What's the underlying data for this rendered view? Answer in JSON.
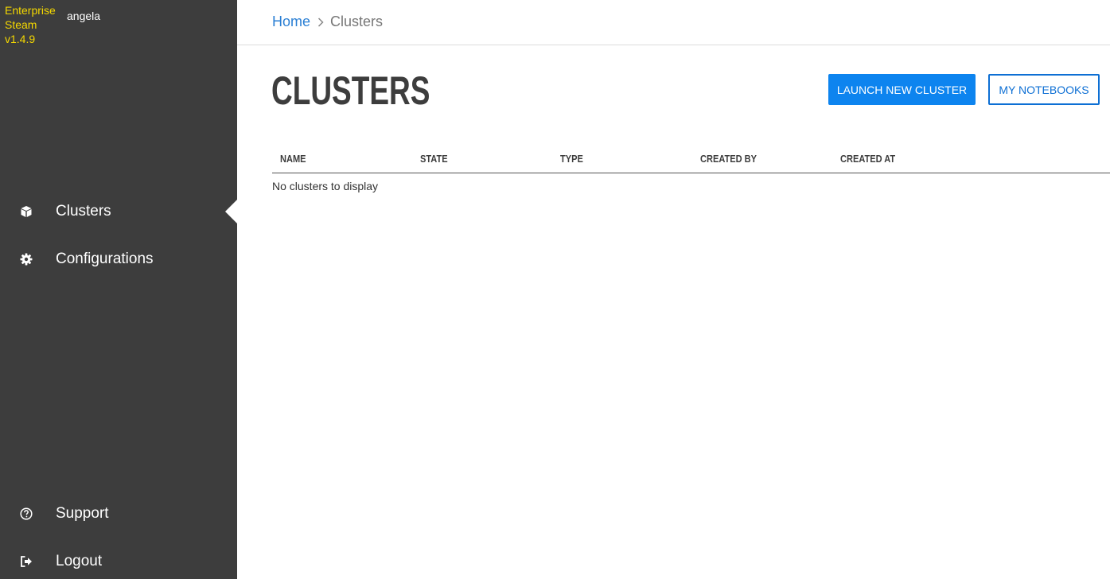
{
  "sidebar": {
    "brand_line1": "Enterprise",
    "brand_line2": "Steam",
    "brand_line3": "v1.4.9",
    "username": "angela",
    "nav": {
      "clusters": "Clusters",
      "configurations": "Configurations",
      "support": "Support",
      "logout": "Logout"
    },
    "active_item": "Clusters"
  },
  "breadcrumb": {
    "home": "Home",
    "current": "Clusters"
  },
  "main": {
    "title": "CLUSTERS",
    "launch_button": "LAUNCH NEW CLUSTER",
    "notebooks_button": "MY NOTEBOOKS"
  },
  "table": {
    "columns": [
      "NAME",
      "STATE",
      "TYPE",
      "CREATED BY",
      "CREATED AT"
    ],
    "empty_message": "No clusters to display"
  },
  "colors": {
    "sidebar_bg": "#3d3d3d",
    "brand": "#f5d800",
    "primary": "#0d84ef",
    "link": "#2a7fd4"
  },
  "icons": {
    "clusters": "cube-icon",
    "configurations": "gear-icon",
    "support": "question-circle-icon",
    "logout": "sign-out-icon",
    "breadcrumb_separator": "chevron-right-icon"
  }
}
